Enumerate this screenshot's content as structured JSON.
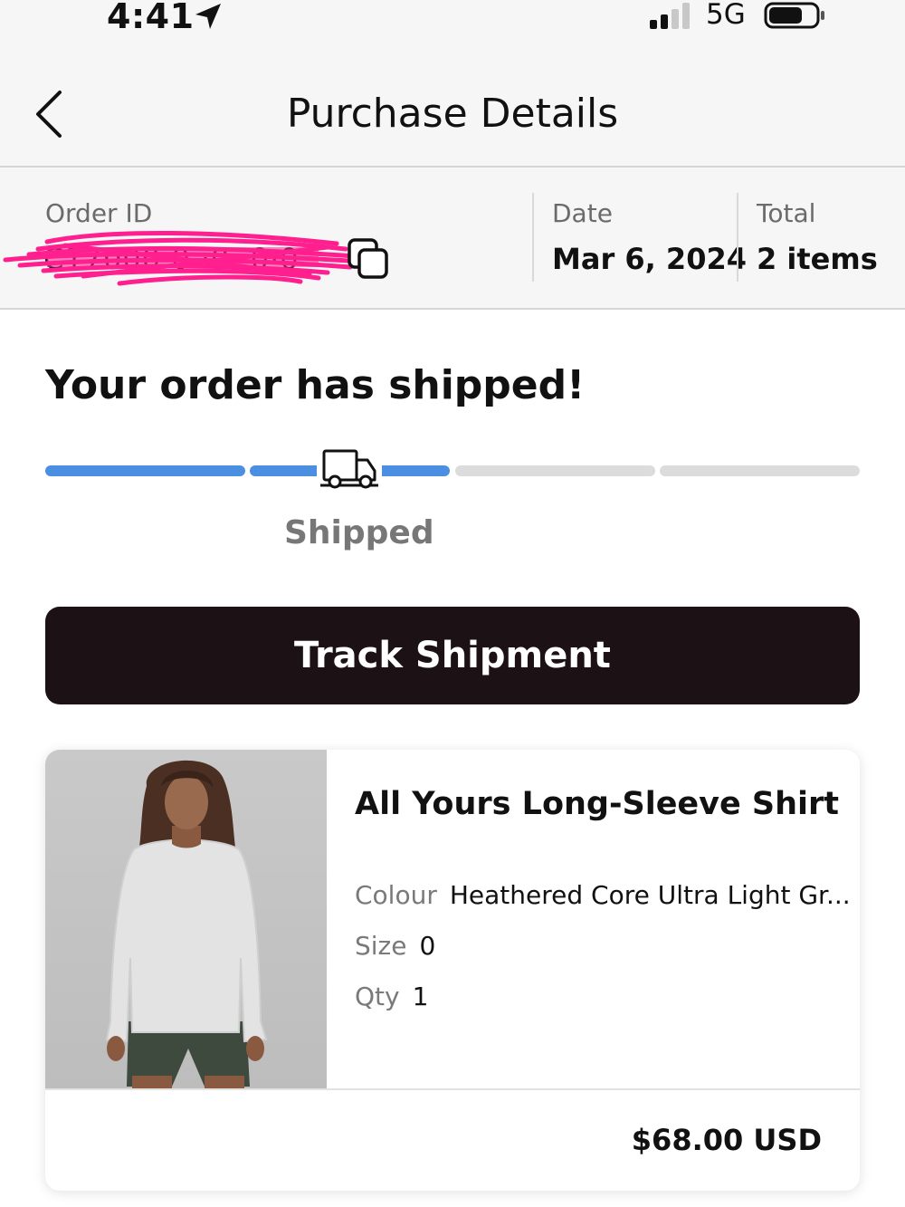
{
  "status_bar": {
    "time": "4:41",
    "network": "5G",
    "icons": [
      "location-arrow-icon",
      "signal-icon",
      "battery-icon"
    ]
  },
  "header": {
    "title": "Purchase Details",
    "back_icon": "chevron-left-icon"
  },
  "order_info": {
    "order_id_label": "Order ID",
    "order_id_value": "C17000  0 ·0  ·0·0",
    "date_label": "Date",
    "date_value": "Mar 6, 2024",
    "total_label": "Total",
    "total_value": "2 items",
    "copy_icon": "copy-icon",
    "redaction_color": "#ff1f8e"
  },
  "shipment": {
    "heading": "Your order has shipped!",
    "progress": {
      "steps_total": 4,
      "steps_complete": 2,
      "current_label": "Shipped",
      "icon": "truck-icon",
      "complete_color": "#4a8fe2",
      "incomplete_color": "#dcdcdc"
    },
    "track_button_label": "Track Shipment"
  },
  "items": [
    {
      "name": "All Yours Long-Sleeve Shirt",
      "colour_label": "Colour",
      "colour_value": "Heathered Core Ultra Light Gr...",
      "size_label": "Size",
      "size_value": "0",
      "qty_label": "Qty",
      "qty_value": "1",
      "price": "$68.00 USD"
    }
  ],
  "colors": {
    "accent": "#4a8fe2",
    "button_bg": "#1c1114",
    "header_bg": "#f6f6f6"
  }
}
